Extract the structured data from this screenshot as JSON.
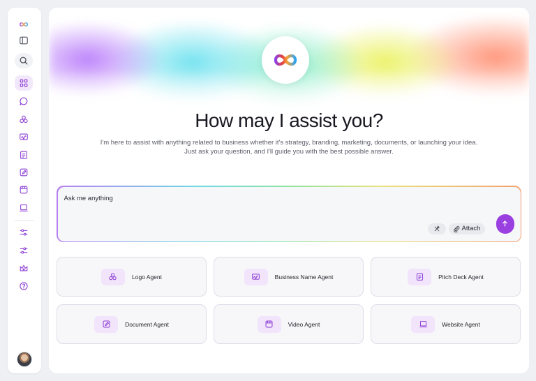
{
  "main": {
    "headline": "How may I assist you?",
    "subtext_line1": "I'm here to assist with anything related to business whether it's strategy, branding, marketing, documents, or launching your idea.",
    "subtext_line2": "Just ask your question, and I'll guide you with the best possible answer."
  },
  "prompt": {
    "placeholder": "Ask me anything",
    "attach_label": "Attach"
  },
  "agents": [
    {
      "label": "Logo Agent",
      "icon": "logo-icon"
    },
    {
      "label": "Business Name Agent",
      "icon": "signature-icon"
    },
    {
      "label": "Pitch Deck Agent",
      "icon": "clipboard-icon"
    },
    {
      "label": "Document Agent",
      "icon": "edit-document-icon"
    },
    {
      "label": "Video Agent",
      "icon": "video-icon"
    },
    {
      "label": "Website Agent",
      "icon": "laptop-icon"
    }
  ],
  "sidebar": {
    "items": [
      {
        "name": "toggle-sidebar",
        "icon": "sidebar-toggle-icon"
      },
      {
        "name": "search",
        "icon": "search-icon"
      },
      {
        "name": "dashboard",
        "icon": "grid-icon",
        "active": true
      },
      {
        "name": "chat",
        "icon": "chat-icon"
      },
      {
        "name": "logo-agent",
        "icon": "logo-icon"
      },
      {
        "name": "business-name-agent",
        "icon": "signature-icon"
      },
      {
        "name": "pitch-deck-agent",
        "icon": "clipboard-icon"
      },
      {
        "name": "document-agent",
        "icon": "edit-document-icon"
      },
      {
        "name": "video-agent",
        "icon": "video-icon"
      },
      {
        "name": "website-agent",
        "icon": "laptop-icon"
      },
      {
        "name": "settings-1",
        "icon": "sliders-icon"
      },
      {
        "name": "settings-2",
        "icon": "sliders-icon"
      },
      {
        "name": "upgrade",
        "icon": "crown-icon"
      },
      {
        "name": "help",
        "icon": "help-icon"
      }
    ]
  },
  "colors": {
    "accent": "#9a3fe0",
    "icon_purple": "#8b3bd4",
    "active_bg": "#f2e8fb"
  }
}
